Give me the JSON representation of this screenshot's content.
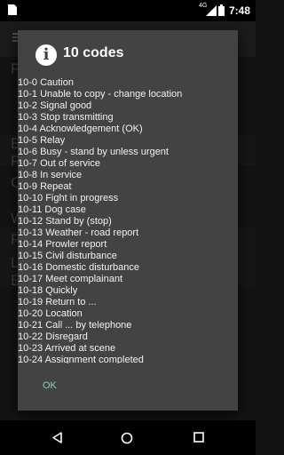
{
  "status_bar": {
    "network_label": "4G",
    "time": "7:48"
  },
  "background": {
    "letters": [
      "P",
      "B",
      "R",
      "C",
      "W",
      "R",
      "L",
      "E"
    ]
  },
  "dialog": {
    "title": "10 codes",
    "icon": "info-icon",
    "codes": [
      "10-0 Caution",
      "10-1 Unable to copy - change location",
      "10-2 Signal good",
      "10-3 Stop transmitting",
      "10-4 Acknowledgement (OK)",
      "10-5 Relay",
      "10-6 Busy - stand by unless urgent",
      "10-7 Out of service",
      "10-8 In service",
      "10-9 Repeat",
      "10-10 Fight in progress",
      "10-11 Dog case",
      "10-12 Stand by (stop)",
      "10-13 Weather - road report",
      "10-14 Prowler report",
      "10-15 Civil disturbance",
      "10-16 Domestic disturbance",
      "10-17 Meet complainant",
      "10-18 Quickly",
      "10-19 Return to ...",
      "10-20 Location",
      "10-21 Call ... by telephone",
      "10-22 Disregard",
      "10-23 Arrived at scene",
      "10-24 Assignment completed"
    ],
    "ok_label": "OK"
  },
  "colors": {
    "dialog_bg": "#434343",
    "accent": "#7fd6c4"
  }
}
